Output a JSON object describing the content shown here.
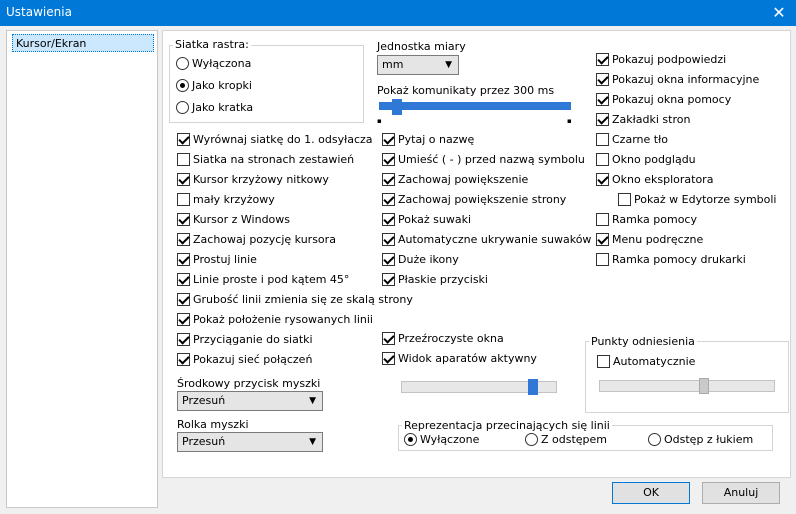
{
  "window": {
    "title": "Ustawienia"
  },
  "sidebar": {
    "items": [
      {
        "label": "Kursor/Ekran"
      }
    ]
  },
  "grid": {
    "title": "Siatka rastra:",
    "options": [
      {
        "label": "Wyłączona",
        "selected": false
      },
      {
        "label": "Jako kropki",
        "selected": true
      },
      {
        "label": "Jako kratka",
        "selected": false
      }
    ]
  },
  "unit": {
    "label": "Jednostka miary",
    "value": "mm"
  },
  "messages": {
    "label": "Pokaż komunikaty przez 300 ms",
    "level": 0.07
  },
  "col1": [
    {
      "label": "Wyrównaj siatkę do 1. odsyłacza",
      "checked": true
    },
    {
      "label": "Siatka na stronach zestawień",
      "checked": false
    },
    {
      "label": "Kursor krzyżowy nitkowy",
      "checked": true
    },
    {
      "label": "mały krzyżowy",
      "checked": false
    },
    {
      "label": "Kursor z Windows",
      "checked": true
    },
    {
      "label": "Zachowaj pozycję kursora",
      "checked": true
    },
    {
      "label": "Prostuj linie",
      "checked": true
    },
    {
      "label": "Linie proste i pod kątem 45°",
      "checked": true
    },
    {
      "label": "Grubość linii zmienia się ze skalą strony",
      "checked": true
    },
    {
      "label": "Pokaż położenie rysowanych linii",
      "checked": true
    },
    {
      "label": "Przyciąganie do siatki",
      "checked": true
    },
    {
      "label": "Pokazuj sieć połączeń",
      "checked": true
    }
  ],
  "col2": [
    {
      "label": "Pytaj o nazwę",
      "checked": true
    },
    {
      "label": "Umieść ( - ) przed nazwą symbolu",
      "checked": true
    },
    {
      "label": "Zachowaj powiększenie",
      "checked": true
    },
    {
      "label": "Zachowaj powiększenie strony",
      "checked": true
    },
    {
      "label": "Pokaż suwaki",
      "checked": true
    },
    {
      "label": "Automatyczne ukrywanie suwaków",
      "checked": true
    },
    {
      "label": "Duże ikony",
      "checked": true
    },
    {
      "label": "Płaskie przyciski",
      "checked": true
    }
  ],
  "col2b": [
    {
      "label": "Przeźroczyste okna",
      "checked": true
    },
    {
      "label": "Widok aparatów aktywny",
      "checked": true
    }
  ],
  "transparency": {
    "level": 0.87
  },
  "col3": [
    {
      "label": "Pokazuj podpowiedzi",
      "checked": true
    },
    {
      "label": "Pokazuj okna informacyjne",
      "checked": true
    },
    {
      "label": "Pokazuj okna pomocy",
      "checked": true
    },
    {
      "label": "Zakładki stron",
      "checked": true
    },
    {
      "label": "Czarne tło",
      "checked": false
    },
    {
      "label": "Okno podglądu",
      "checked": false
    },
    {
      "label": "Okno eksploratora",
      "checked": true
    },
    {
      "label": "Pokaż w Edytorze symboli",
      "checked": false
    },
    {
      "label": "Ramka pomocy",
      "checked": false
    },
    {
      "label": "Menu podręczne",
      "checked": true
    },
    {
      "label": "Ramka pomocy drukarki",
      "checked": false
    }
  ],
  "ref": {
    "title": "Punkty odniesienia",
    "auto_label": "Automatycznie",
    "auto_checked": false,
    "level": 0.6
  },
  "middle_mouse": {
    "label": "Środkowy przycisk myszki",
    "value": "Przesuń"
  },
  "mouse_wheel": {
    "label": "Rolka myszki",
    "value": "Przesuń"
  },
  "crossing": {
    "title": "Reprezentacja przecinających się linii",
    "options": [
      {
        "label": "Wyłączone",
        "selected": true
      },
      {
        "label": "Z odstępem",
        "selected": false
      },
      {
        "label": "Odstęp z łukiem",
        "selected": false
      }
    ]
  },
  "buttons": {
    "ok": "OK",
    "cancel": "Anuluj"
  }
}
